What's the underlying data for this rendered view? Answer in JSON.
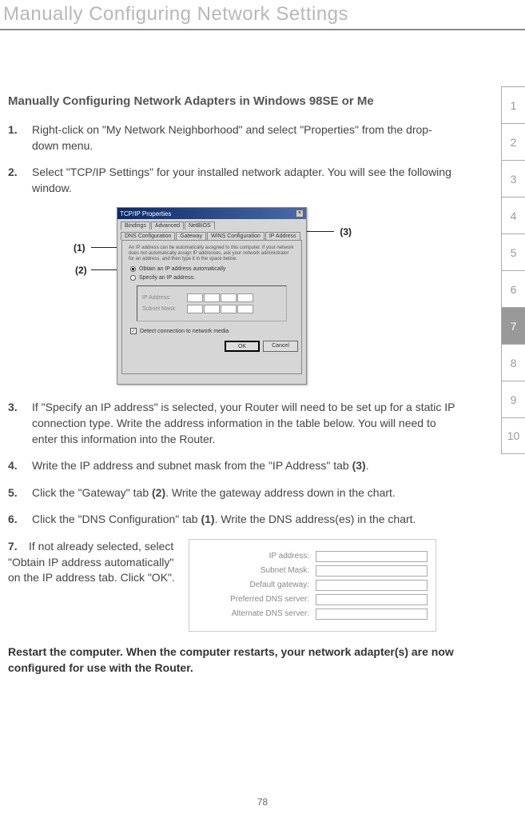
{
  "header": {
    "title": "Manually Configuring Network Settings"
  },
  "section_title": "Manually Configuring Network Adapters in Windows 98SE or Me",
  "steps": {
    "s1_num": "1.",
    "s1": "Right-click on \"My Network Neighborhood\" and select \"Properties\" from the drop-down menu.",
    "s2_num": "2.",
    "s2": "Select \"TCP/IP Settings\" for your installed network adapter. You will see the following window.",
    "s3_num": "3.",
    "s3": "If \"Specify an IP address\" is selected, your Router will need to be set up for a static IP connection type. Write the address information in the table below. You will need to enter this information into the Router.",
    "s4_num": "4.",
    "s4_pre": "Write the IP address and subnet mask from the \"IP Address\" tab ",
    "s4_bold": "(3)",
    "s4_post": ".",
    "s5_num": "5.",
    "s5_pre": "Click the \"Gateway\" tab ",
    "s5_bold": "(2)",
    "s5_post": ". Write the gateway address down in the chart.",
    "s6_num": "6.",
    "s6_pre": "Click the \"DNS Configuration\" tab ",
    "s6_bold": "(1)",
    "s6_post": ". Write the DNS address(es) in the chart.",
    "s7_num": "7.",
    "s7": "If not already selected, select \"Obtain IP address automatically\" on the IP address tab. Click \"OK\"."
  },
  "callouts": {
    "c1": "(1)",
    "c2": "(2)",
    "c3": "(3)"
  },
  "dialog": {
    "title": "TCP/IP Properties",
    "tabs": {
      "t1": "Bindings",
      "t2": "Advanced",
      "t3": "NetBIOS",
      "t4": "DNS Configuration",
      "t5": "Gateway",
      "t6": "WINS Configuration",
      "t7": "IP Address"
    },
    "blurb": "An IP address can be automatically assigned to this computer. If your network does not automatically assign IP addresses, ask your network administrator for an address, and then type it in the space below.",
    "radio1": "Obtain an IP address automatically",
    "radio2": "Specify an IP address:",
    "ip_label": "IP Address:",
    "subnet_label": "Subnet Mask:",
    "detect": "Detect connection to network media",
    "ok": "OK",
    "cancel": "Cancel"
  },
  "form": {
    "f1": "IP address:",
    "f2": "Subnet Mask:",
    "f3": "Default gateway:",
    "f4": "Preferred DNS server:",
    "f5": "Alternate DNS server:"
  },
  "restart": "Restart the computer. When the computer restarts, your network adapter(s) are now configured for use with the Router.",
  "sidebar": {
    "items": [
      "1",
      "2",
      "3",
      "4",
      "5",
      "6",
      "7",
      "8",
      "9",
      "10"
    ],
    "active_index": 6
  },
  "page_number": "78"
}
